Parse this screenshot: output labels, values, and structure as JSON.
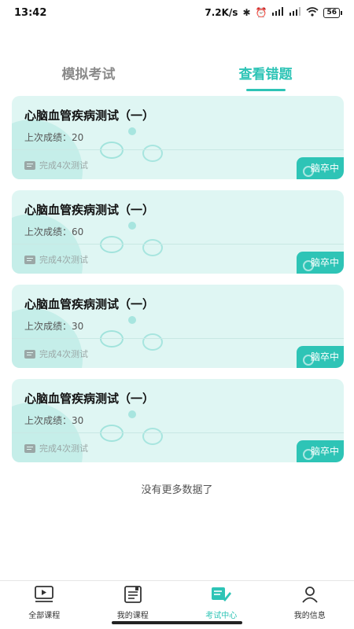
{
  "status_bar": {
    "time": "13:42",
    "net_speed": "7.2K/s",
    "battery": "56",
    "icons": [
      "bluetooth-icon",
      "alarm-icon",
      "signal-hd-icon",
      "signal-icon",
      "wifi-icon",
      "battery-icon"
    ]
  },
  "tabs": [
    {
      "label": "模拟考试",
      "active": false
    },
    {
      "label": "查看错题",
      "active": true
    }
  ],
  "cards": [
    {
      "title": "心脑血管疾病测试（一）",
      "score_label": "上次成绩：",
      "score": "20",
      "progress": "完成4次测试",
      "tag": "脑卒中"
    },
    {
      "title": "心脑血管疾病测试（一）",
      "score_label": "上次成绩：",
      "score": "60",
      "progress": "完成4次测试",
      "tag": "脑卒中"
    },
    {
      "title": "心脑血管疾病测试（一）",
      "score_label": "上次成绩：",
      "score": "30",
      "progress": "完成4次测试",
      "tag": "脑卒中"
    },
    {
      "title": "心脑血管疾病测试（一）",
      "score_label": "上次成绩：",
      "score": "30",
      "progress": "完成4次测试",
      "tag": "脑卒中"
    }
  ],
  "no_more": "没有更多数据了",
  "bottom_nav": [
    {
      "label": "全部课程",
      "icon": "video-book-icon",
      "active": false
    },
    {
      "label": "我的课程",
      "icon": "notebook-icon",
      "active": false
    },
    {
      "label": "考试中心",
      "icon": "exam-edit-icon",
      "active": true
    },
    {
      "label": "我的信息",
      "icon": "person-icon",
      "active": false
    }
  ],
  "colors": {
    "accent": "#2ec4b6",
    "card_bg": "#dff6f3",
    "inactive_text": "#8a8a8a"
  }
}
